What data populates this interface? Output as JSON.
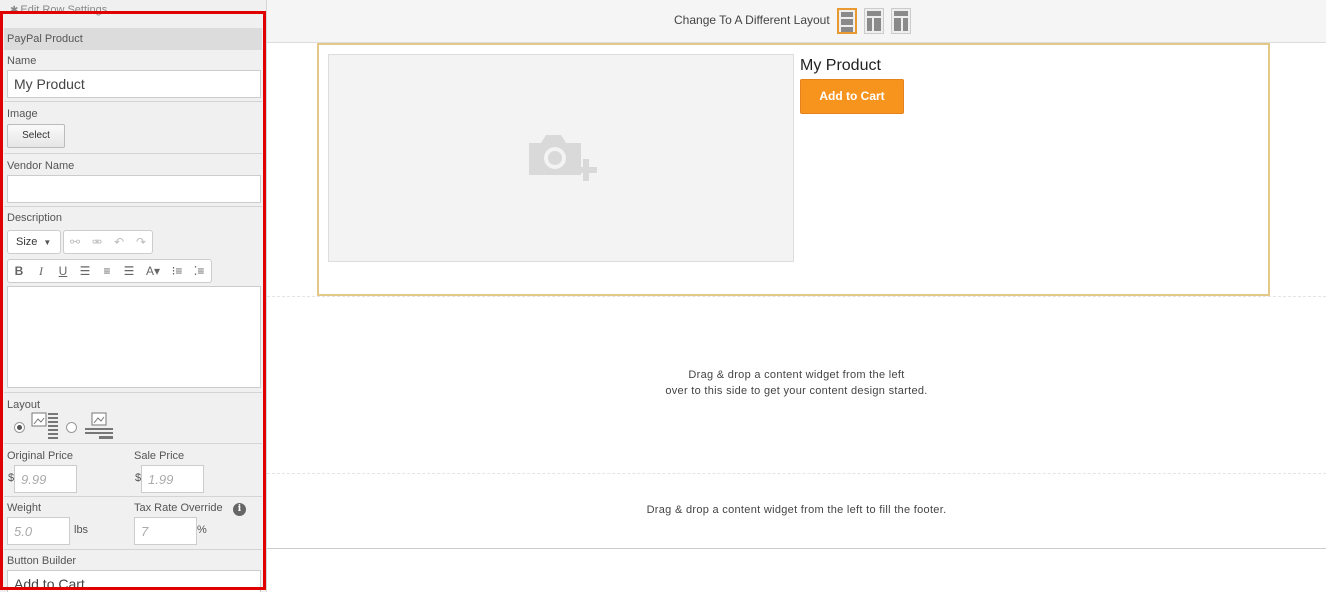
{
  "left_panel": {
    "edit_row_label": "Edit Row Settings",
    "header": "PayPal Product",
    "name": {
      "label": "Name",
      "value": "My Product"
    },
    "image": {
      "label": "Image",
      "button": "Select"
    },
    "vendor": {
      "label": "Vendor Name",
      "value": ""
    },
    "description": {
      "label": "Description",
      "size_label": "Size"
    },
    "layout": {
      "label": "Layout",
      "selected": "image-left"
    },
    "original_price": {
      "label": "Original Price",
      "currency": "$",
      "placeholder": "9.99"
    },
    "sale_price": {
      "label": "Sale Price",
      "currency": "$",
      "placeholder": "1.99"
    },
    "weight": {
      "label": "Weight",
      "placeholder": "5.0",
      "unit": "lbs"
    },
    "tax": {
      "label": "Tax Rate Override",
      "placeholder": "7",
      "unit": "%",
      "info": "i"
    },
    "button_builder": {
      "label": "Button Builder",
      "value": "Add to Cart"
    }
  },
  "topbar": {
    "change_layout_label": "Change To A Different Layout",
    "layout_options": [
      "layout-single-column",
      "layout-sidebar-left",
      "layout-sidebar-right"
    ],
    "selected_layout": 0
  },
  "product": {
    "title": "My Product",
    "button_label": "Add to Cart",
    "button_color": "#f7941d"
  },
  "drop_zone": {
    "line1": "Drag & drop a content widget from the left",
    "line2": "over to this side to get your content design started."
  },
  "footer_zone": {
    "text": "Drag & drop a content widget from the left to fill the footer."
  },
  "colors": {
    "highlight_outline": "#e00000",
    "accent": "#e89a30"
  }
}
